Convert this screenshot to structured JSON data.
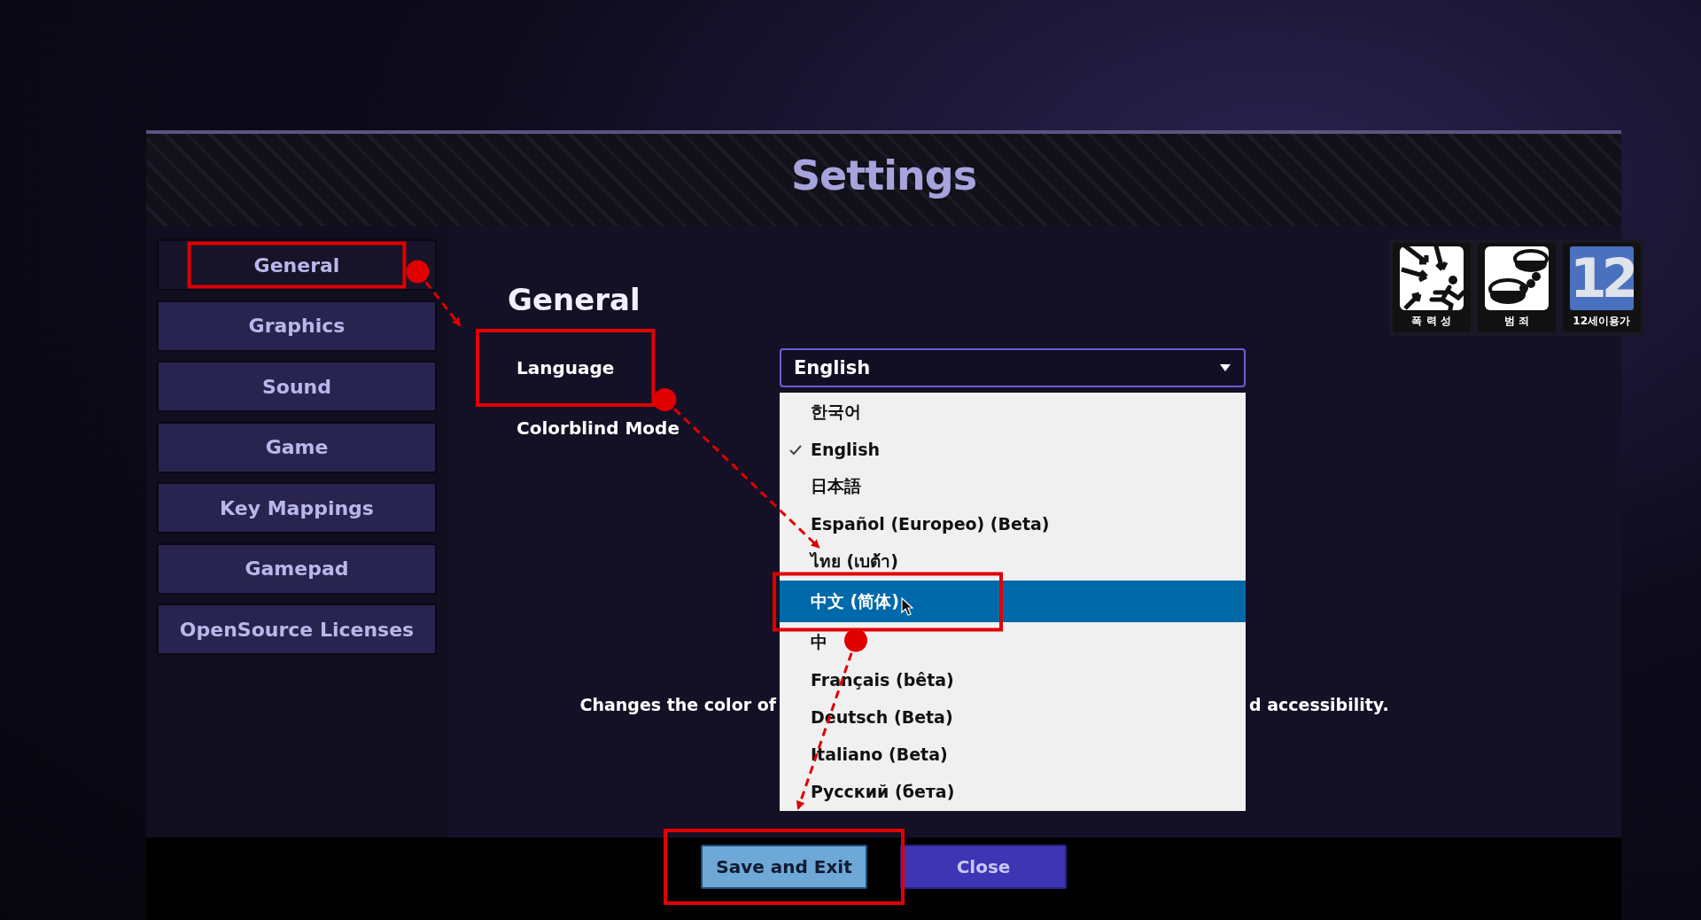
{
  "window": {
    "title": "Settings"
  },
  "sidebar": {
    "items": [
      {
        "label": "General",
        "selected": true,
        "annotated": true
      },
      {
        "label": "Graphics",
        "selected": false,
        "annotated": false
      },
      {
        "label": "Sound",
        "selected": false,
        "annotated": false
      },
      {
        "label": "Game",
        "selected": false,
        "annotated": false
      },
      {
        "label": "Key Mappings",
        "selected": false,
        "annotated": false
      },
      {
        "label": "Gamepad",
        "selected": false,
        "annotated": false
      },
      {
        "label": "OpenSource Licenses",
        "selected": false,
        "annotated": false
      }
    ]
  },
  "content": {
    "heading": "General",
    "settings": [
      {
        "label": "Language",
        "annotated": true
      },
      {
        "label": "Colorblind Mode",
        "annotated": false
      }
    ],
    "language_dropdown": {
      "value": "English",
      "expanded": true,
      "options": [
        {
          "label": "한국어",
          "selected": false,
          "hovered": false,
          "annotated": false
        },
        {
          "label": "English",
          "selected": true,
          "hovered": false,
          "annotated": false
        },
        {
          "label": "日本語",
          "selected": false,
          "hovered": false,
          "annotated": false
        },
        {
          "label": "Español (Europeo) (Beta)",
          "selected": false,
          "hovered": false,
          "annotated": false
        },
        {
          "label": "ไทย (เบต้า)",
          "selected": false,
          "hovered": false,
          "annotated": false
        },
        {
          "label": "中文 (简体)",
          "selected": false,
          "hovered": true,
          "annotated": true
        },
        {
          "label": "中",
          "selected": false,
          "hovered": false,
          "annotated": false
        },
        {
          "label": "Français (bêta)",
          "selected": false,
          "hovered": false,
          "annotated": false
        },
        {
          "label": "Deutsch (Beta)",
          "selected": false,
          "hovered": false,
          "annotated": false
        },
        {
          "label": "Italiano (Beta)",
          "selected": false,
          "hovered": false,
          "annotated": false
        },
        {
          "label": "Русский (бета)",
          "selected": false,
          "hovered": false,
          "annotated": false
        }
      ]
    },
    "description": [
      "Changes the color of",
      "d accessibility."
    ]
  },
  "rating_badges": [
    {
      "kind": "violence",
      "label": "폭 력 성"
    },
    {
      "kind": "crime",
      "label": "범 죄"
    },
    {
      "kind": "age",
      "number": "12",
      "label": "12세이용가"
    }
  ],
  "buttons": [
    {
      "label": "Save and Exit",
      "kind": "primary",
      "annotated": true
    },
    {
      "label": "Close",
      "kind": "secondary",
      "annotated": false
    }
  ]
}
